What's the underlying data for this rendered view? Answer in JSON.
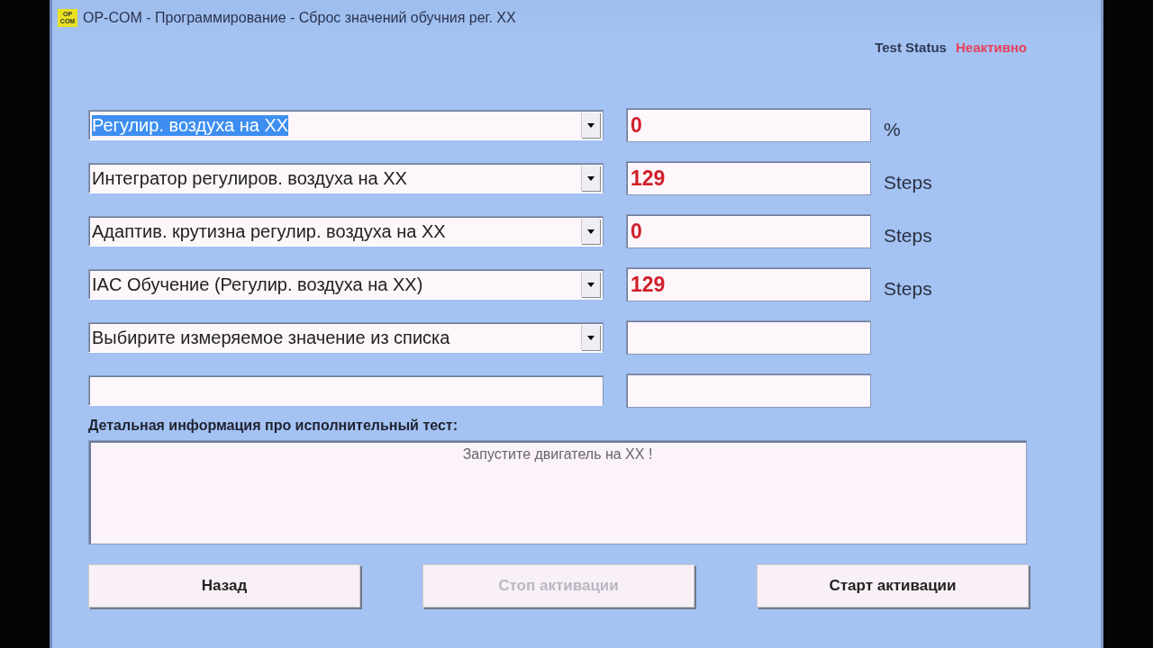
{
  "window": {
    "title": "OP-COM - Программирование - Сброс значений обучния рег. XX",
    "icon_text": [
      "OP",
      "COM"
    ]
  },
  "status": {
    "label": "Test Status",
    "value": "Неактивно"
  },
  "rows": [
    {
      "kind": "dropdown",
      "selector": "Регулир. воздуха на XX",
      "text_selected": true,
      "value": "0",
      "unit": "%"
    },
    {
      "kind": "dropdown",
      "selector": "Интегратор регулиров. воздуха на XX",
      "text_selected": false,
      "value": "129",
      "unit": "Steps"
    },
    {
      "kind": "dropdown",
      "selector": "Адаптив. крутизна регулир. воздуха на XX",
      "text_selected": false,
      "value": "0",
      "unit": "Steps"
    },
    {
      "kind": "dropdown",
      "selector": "IAC Обучение (Регулир. воздуха на XX)",
      "text_selected": false,
      "value": "129",
      "unit": "Steps"
    },
    {
      "kind": "dropdown",
      "selector": "Выбирите измеряемое значение из списка",
      "text_selected": false
    },
    {
      "kind": "text"
    }
  ],
  "details": {
    "label": "Детальная информация про исполнительный тест:",
    "text": "Запустите двигатель на XX !"
  },
  "buttons": [
    {
      "label": "Назад",
      "disabled": false
    },
    {
      "label": "Стоп активации",
      "disabled": true
    },
    {
      "label": "Старт активации",
      "disabled": false
    }
  ]
}
